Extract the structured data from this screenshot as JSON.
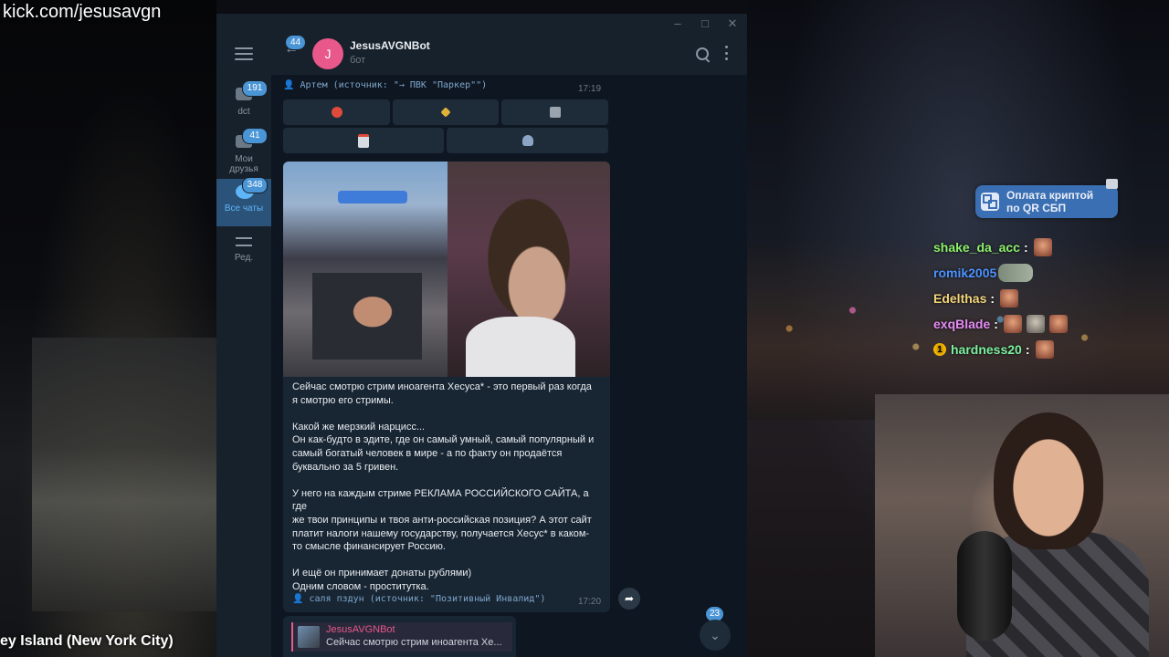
{
  "stream": {
    "watermark": "kick.com/jesusavgn",
    "location": "ey Island (New York City)",
    "crypto_button": "Оплата криптой\nпо QR СБП",
    "chat": [
      {
        "user": "shake_da_acc",
        "color": "#8cf06b",
        "emotes": 1,
        "badge": false
      },
      {
        "user": "romik2005",
        "color": "#4d93ff",
        "emotes": 1,
        "badge": false
      },
      {
        "user": "Edelthas",
        "color": "#f2d47a",
        "emotes": 1,
        "badge": false
      },
      {
        "user": "exqBlade",
        "color": "#e58cf5",
        "emotes": 3,
        "badge": false
      },
      {
        "user": "hardness20",
        "color": "#7cf0a0",
        "emotes": 1,
        "badge": true,
        "badge_label": "1"
      }
    ]
  },
  "window": {
    "controls": {
      "minimize": "–",
      "maximize": "□",
      "close": "✕"
    }
  },
  "sidebar": {
    "folders": [
      {
        "label": "dct",
        "badge": "191",
        "active": false
      },
      {
        "label": "Мои\nдрузья",
        "badge": "41",
        "active": false
      },
      {
        "label": "Все чаты",
        "badge": "348",
        "active": true
      },
      {
        "label": "Ред.",
        "badge": "",
        "active": false
      }
    ]
  },
  "header": {
    "back_badge": "44",
    "avatar_letter": "J",
    "title": "JesusAVGNBot",
    "subtitle": "бот",
    "avatar_color": "#e8588a"
  },
  "messages": {
    "previous": {
      "sender": "Артем (источник: \"→ ПВК \"Паркер\"\")",
      "time": "17:19"
    },
    "keyboard": [
      {
        "icon": "stop-icon",
        "color": "#e04a3a"
      },
      {
        "icon": "broom-icon",
        "color": "#e0b23a"
      },
      {
        "icon": "trash-icon",
        "color": "#9aa4ae"
      },
      {
        "icon": "calendar-icon",
        "color": "#d6dce2"
      },
      {
        "icon": "user-icon",
        "color": "#8aa6c4"
      }
    ],
    "main": {
      "paragraphs": [
        "Сейчас смотрю стрим иноагента Хесуса* - это первый раз когда\nя смотрю его стримы.",
        "Какой же мерзкий нарцисс...\nОн как-будто в эдите, где он самый умный, самый популярный и\nсамый богатый человек в мире - а по факту он продаётся\nбуквально за 5 гривен.",
        "У него на каждым стриме РЕКЛАМА РОССИЙСКОГО САЙТА, а где\nже твои принципы и твоя анти-российская позиция? А этот сайт\nплатит налоги нашему государству, получается Хесус* в каком-\nто смысле финансирует Россию.",
        "И ещё он принимает донаты рублями)\nОдним словом - проститутка."
      ],
      "sender": "саля пздун (источник: \"Позитивный Инвалид\")",
      "time": "17:20"
    },
    "scroll_badge": "23",
    "reply": {
      "name": "JesusAVGNBot",
      "text": "Сейчас смотрю стрим иноагента Хе..."
    }
  }
}
